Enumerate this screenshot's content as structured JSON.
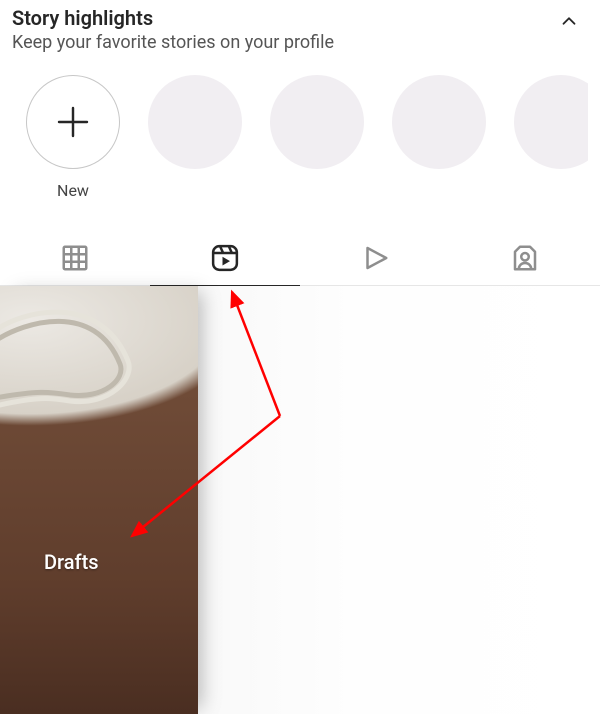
{
  "highlights": {
    "title": "Story highlights",
    "subtitle": "Keep your favorite stories on your profile",
    "new_label": "New"
  },
  "tabs": {
    "grid": "Posts grid",
    "reels": "Reels",
    "video": "Video",
    "tagged": "Tagged"
  },
  "content": {
    "drafts_label": "Drafts"
  },
  "annotation": {
    "color": "#ff0000"
  }
}
